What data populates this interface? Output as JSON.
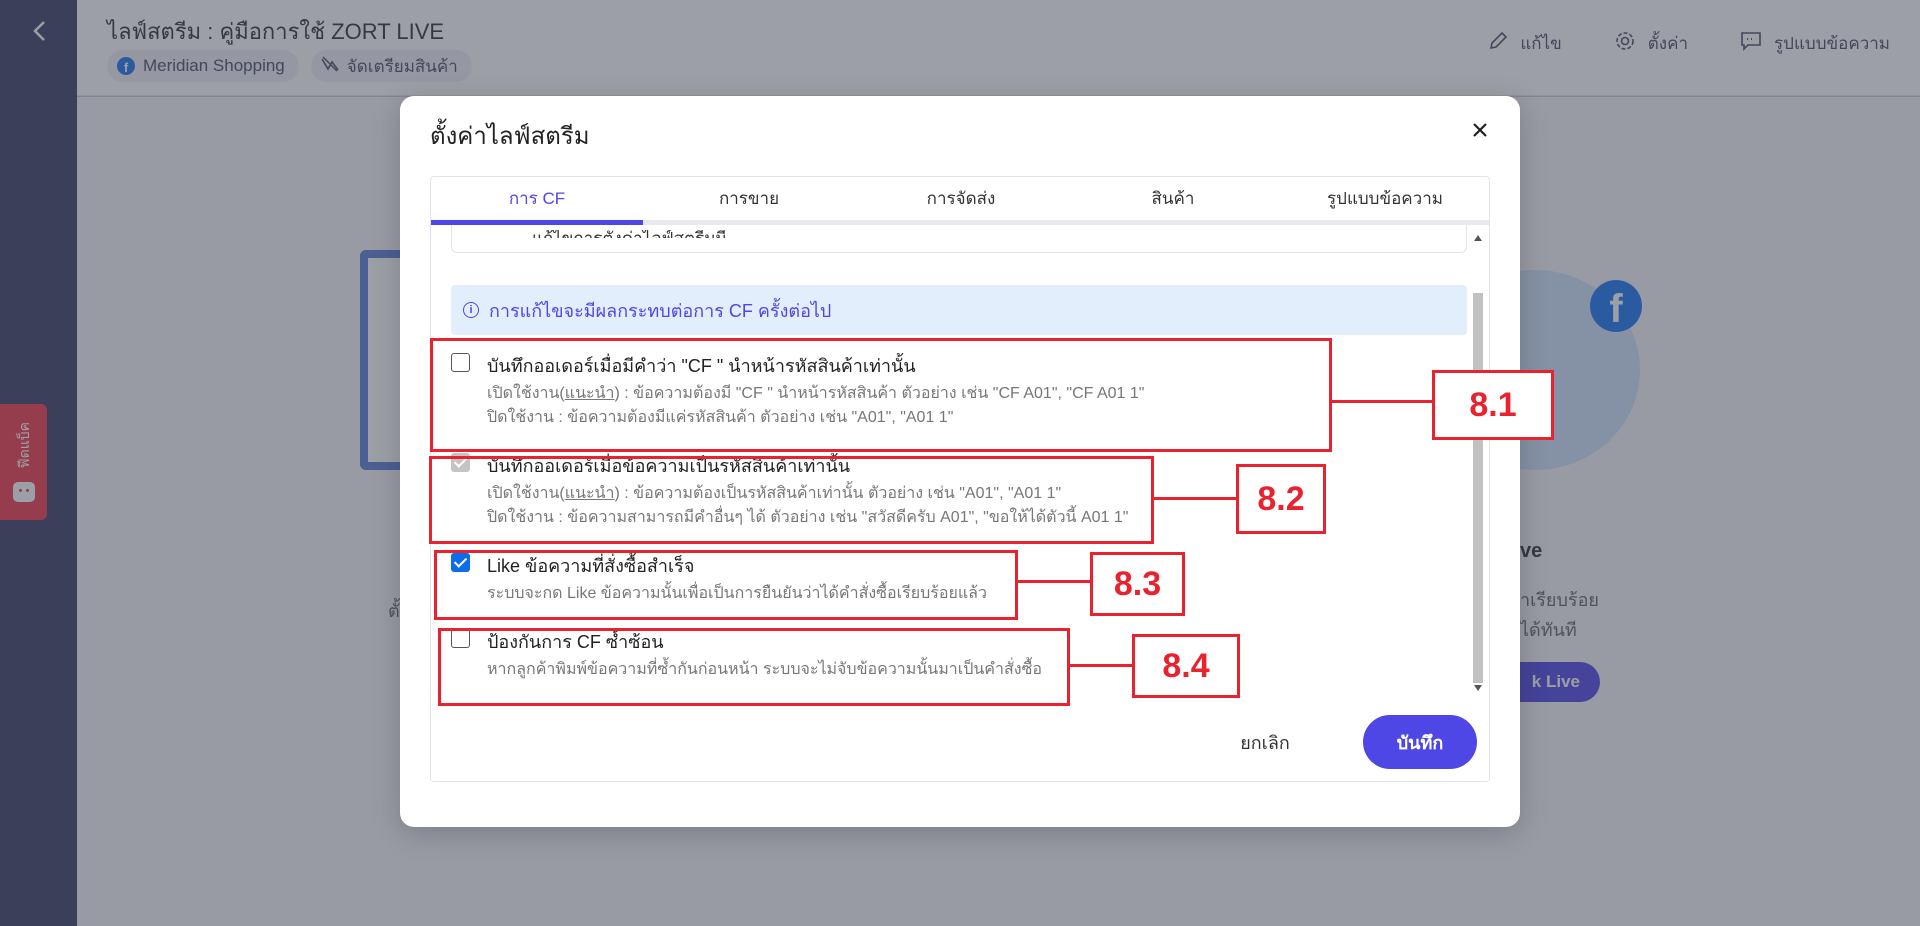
{
  "header": {
    "title": "ไลฟ์สตรีม : คู่มือการใช้ ZORT LIVE",
    "tags": [
      {
        "label": "Meridian Shopping",
        "icon": "facebook-icon"
      },
      {
        "label": "จัดเตรียมสินค้า",
        "icon": "pending-icon"
      }
    ],
    "actions": [
      {
        "label": "แก้ไข",
        "icon": "pencil-icon"
      },
      {
        "label": "ตั้งค่า",
        "icon": "gear-icon"
      },
      {
        "label": "รูปแบบข้อความ",
        "icon": "message-icon"
      }
    ]
  },
  "chat_tab": {
    "label": "ฟีดแบ็ค"
  },
  "background": {
    "text_right_1": "ve",
    "text_right_2a": "ำเรียบร้อย",
    "text_right_2b": "ได้ทันที",
    "button": "k Live",
    "text_left": "ตั้"
  },
  "modal": {
    "title": "ตั้งค่าไลฟ์สตรีม",
    "tabs": [
      {
        "label": "การ CF",
        "active": true
      },
      {
        "label": "การขาย",
        "active": false
      },
      {
        "label": "การจัดส่ง",
        "active": false
      },
      {
        "label": "สินค้า",
        "active": false
      },
      {
        "label": "รูปแบบข้อความ",
        "active": false
      }
    ],
    "prev_card_text": "แก้ไขการตั้งค่าไลฟ์สตรีมนี้",
    "info_text": "การแก้ไขจะมีผลกระทบต่อการ CF ครั้งต่อไป",
    "options": [
      {
        "title": "บันทึกออเดอร์เมื่อมีคำว่า \"CF \" นำหน้ารหัสสินค้าเท่านั้น",
        "desc_on_prefix": "เปิดใช้งาน(",
        "desc_on_link": "แนะนำ",
        "desc_on_suffix": ") : ข้อความต้องมี \"CF \" นำหน้ารหัสสินค้า ตัวอย่าง เช่น \"CF A01\", \"CF A01 1\"",
        "desc_off": "ปิดใช้งาน : ข้อความต้องมีแค่รหัสสินค้า ตัวอย่าง เช่น \"A01\", \"A01 1\"",
        "checked": false
      },
      {
        "title": "บันทึกออเดอร์เมื่อข้อความเป็นรหัสสินค้าเท่านั้น",
        "desc_on_prefix": "เปิดใช้งาน(",
        "desc_on_link": "แนะนำ",
        "desc_on_suffix": ") : ข้อความต้องเป็นรหัสสินค้าเท่านั้น ตัวอย่าง เช่น \"A01\", \"A01 1\"",
        "desc_off": "ปิดใช้งาน : ข้อความสามารถมีคำอื่นๆ ได้ ตัวอย่าง เช่น \"สวัสดีครับ A01\", \"ขอให้ได้ตัวนี้ A01 1\"",
        "checked": true,
        "disabled": true
      },
      {
        "title": "Like ข้อความที่สั่งซื้อสำเร็จ",
        "desc": "ระบบจะกด Like ข้อความนั้นเพื่อเป็นการยืนยันว่าได้คำสั่งซื้อเรียบร้อยแล้ว",
        "checked": true
      },
      {
        "title": "ป้องกันการ CF ซ้ำซ้อน",
        "desc": "หากลูกค้าพิมพ์ข้อความที่ซ้ำกันก่อนหน้า ระบบจะไม่จับข้อความนั้นมาเป็นคำสั่งซื้อ",
        "checked": false
      }
    ],
    "cancel_label": "ยกเลิก",
    "save_label": "บันทึก"
  },
  "annotations": [
    "8.1",
    "8.2",
    "8.3",
    "8.4"
  ],
  "colors": {
    "accent": "#4e46e5",
    "annotation": "#e8232f",
    "checkbox": "#0b6ee8"
  }
}
